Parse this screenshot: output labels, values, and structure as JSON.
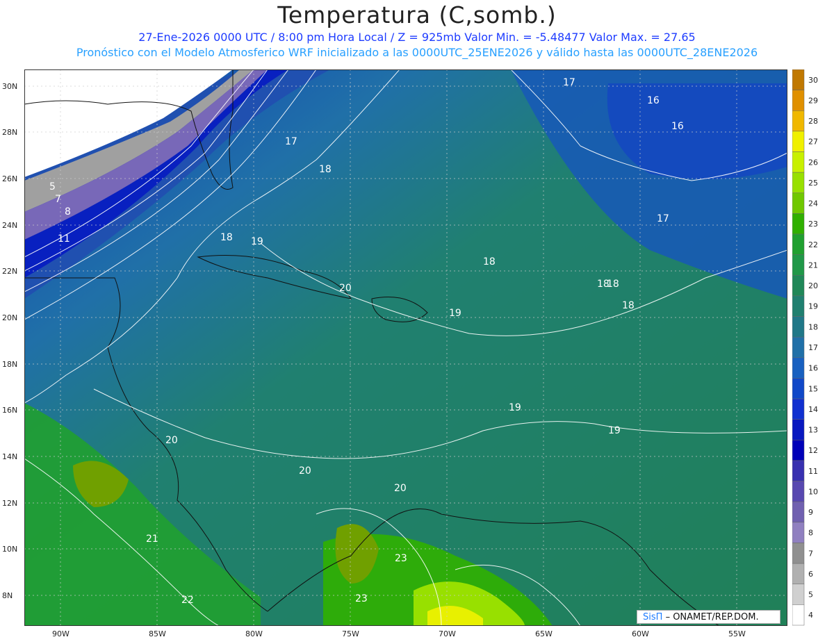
{
  "header": {
    "title": "Temperatura (C,somb.)",
    "line1": "27-Ene-2026  0000 UTC / 8:00 pm Hora Local / Z = 925mb    Valor Min. = -5.48477  Valor Max. = 27.65",
    "line2": "Pronóstico con el Modelo Atmosferico WRF inicializado a las 0000UTC_25ENE2026 y válido hasta las  0000UTC_28ENE2026"
  },
  "axes": {
    "lon_labels": [
      "90W",
      "85W",
      "80W",
      "75W",
      "70W",
      "65W",
      "60W",
      "55W"
    ],
    "lat_labels": [
      "30N",
      "28N",
      "26N",
      "24N",
      "22N",
      "20N",
      "18N",
      "16N",
      "14N",
      "12N",
      "10N",
      "8N"
    ]
  },
  "colorbar": {
    "labels": [
      "30",
      "29",
      "28",
      "27",
      "26",
      "25",
      "24",
      "23",
      "22",
      "21",
      "20",
      "19",
      "18",
      "17",
      "16",
      "15",
      "14",
      "13",
      "12",
      "11",
      "10",
      "9",
      "8",
      "7",
      "6",
      "5",
      "4"
    ],
    "colors": [
      "#c07800",
      "#e09000",
      "#f0b800",
      "#f0f000",
      "#c8f000",
      "#98e000",
      "#70c800",
      "#30b000",
      "#20a030",
      "#209848",
      "#208858",
      "#208070",
      "#207888",
      "#2070a8",
      "#1860c0",
      "#1048c8",
      "#1030d0",
      "#0818c0",
      "#0000b8",
      "#3830b0",
      "#5848b0",
      "#7060b0",
      "#9080c0",
      "#909090",
      "#b0b0b0",
      "#d0d0d0",
      "#ffffff"
    ]
  },
  "contour_labels": [
    "5",
    "7",
    "8",
    "11",
    "16",
    "16",
    "17",
    "17",
    "17",
    "18",
    "18",
    "18",
    "18",
    "18",
    "18",
    "19",
    "19",
    "19",
    "19",
    "20",
    "20",
    "20",
    "20",
    "21",
    "22",
    "23",
    "23"
  ],
  "credit": {
    "brand": "SisΠ",
    "text": "– ONAMET/REP.DOM."
  }
}
